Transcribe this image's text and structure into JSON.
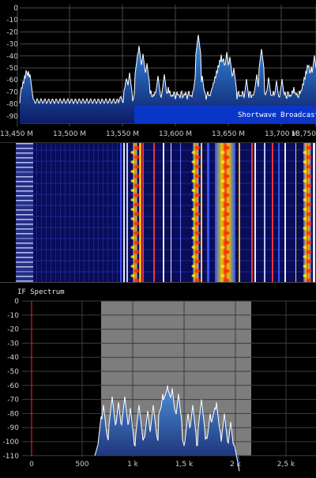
{
  "colors": {
    "background": "#000000",
    "grid": "#4a4a4a",
    "trace": "#ffffff",
    "spectrum_fill_top": "#2e84d6",
    "spectrum_fill_bottom": "#0b1c6a",
    "band_bar": "#0a36c8",
    "if_filter": "#7b7b7b",
    "marker_red": "#ff2a2a"
  },
  "rf_spectrum": {
    "db_ticks": [
      "0",
      "-10",
      "-20",
      "-30",
      "-40",
      "-50",
      "-60",
      "-70",
      "-80",
      "-90"
    ],
    "freq_ticks": [
      "13,450 M",
      "13,500 M",
      "13,550 M",
      "13,600 M",
      "13,650 M",
      "13,700 M",
      "13,750"
    ],
    "band_label": "Shortwave Broadcast"
  },
  "waterfall": {
    "icon": "waterfall-display"
  },
  "if_spectrum": {
    "title": "IF Spectrum",
    "db_ticks": [
      "0",
      "-10",
      "-20",
      "-30",
      "-40",
      "-50",
      "-60",
      "-70",
      "-80",
      "-90",
      "-100",
      "-110"
    ],
    "freq_ticks": [
      "0",
      "500",
      "1 k",
      "1,5 k",
      "2 k",
      "2,5 k"
    ]
  }
}
